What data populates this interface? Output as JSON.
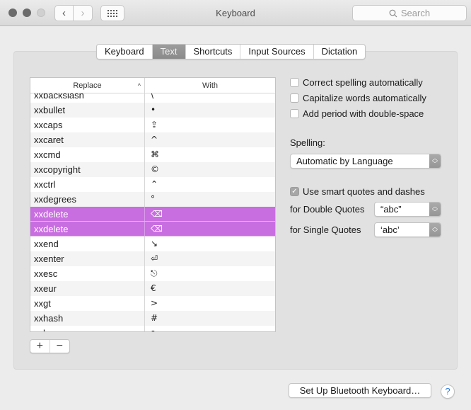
{
  "window": {
    "title": "Keyboard",
    "search_placeholder": "Search"
  },
  "toolbar": {
    "back_glyph": "‹",
    "forward_glyph": "›"
  },
  "tabs": [
    {
      "label": "Keyboard",
      "active": false
    },
    {
      "label": "Text",
      "active": true
    },
    {
      "label": "Shortcuts",
      "active": false
    },
    {
      "label": "Input Sources",
      "active": false
    },
    {
      "label": "Dictation",
      "active": false
    }
  ],
  "table": {
    "columns": {
      "replace": "Replace",
      "with": "With"
    },
    "sort_glyph": "^",
    "rows": [
      {
        "replace": "xxbackslash",
        "with": "\\",
        "selected": false
      },
      {
        "replace": "xxbullet",
        "with": "•",
        "selected": false
      },
      {
        "replace": "xxcaps",
        "with": "⇪",
        "selected": false
      },
      {
        "replace": "xxcaret",
        "with": "^",
        "selected": false
      },
      {
        "replace": "xxcmd",
        "with": "⌘",
        "selected": false
      },
      {
        "replace": "xxcopyright",
        "with": "©",
        "selected": false
      },
      {
        "replace": "xxctrl",
        "with": "⌃",
        "selected": false
      },
      {
        "replace": "xxdegrees",
        "with": "°",
        "selected": false
      },
      {
        "replace": "xxdelete",
        "with": "⌫",
        "selected": true
      },
      {
        "replace": "xxdelete",
        "with": "⌫",
        "selected": true
      },
      {
        "replace": "xxend",
        "with": "↘",
        "selected": false
      },
      {
        "replace": "xxenter",
        "with": "⏎",
        "selected": false
      },
      {
        "replace": "xxesc",
        "with": "⎋",
        "selected": false
      },
      {
        "replace": "xxeur",
        "with": "€",
        "selected": false
      },
      {
        "replace": "xxgt",
        "with": ">",
        "selected": false
      },
      {
        "replace": "xxhash",
        "with": "#",
        "selected": false
      },
      {
        "replace": "xxhome",
        "with": "↖",
        "selected": false
      }
    ],
    "selection_color": "#c86ee0"
  },
  "table_controls": {
    "add": "+",
    "remove": "−"
  },
  "options": {
    "correct_spelling": {
      "label": "Correct spelling automatically",
      "checked": false
    },
    "capitalize_words": {
      "label": "Capitalize words automatically",
      "checked": false
    },
    "add_period": {
      "label": "Add period with double-space",
      "checked": false
    },
    "spelling_label": "Spelling:",
    "spelling_value": "Automatic by Language",
    "smart_quotes": {
      "label": "Use smart quotes and dashes",
      "checked": true
    },
    "double_quotes_label": "for Double Quotes",
    "double_quotes_value": "“abc”",
    "single_quotes_label": "for Single Quotes",
    "single_quotes_value": "‘abc’"
  },
  "footer": {
    "bluetooth_button": "Set Up Bluetooth Keyboard…",
    "help": "?"
  }
}
